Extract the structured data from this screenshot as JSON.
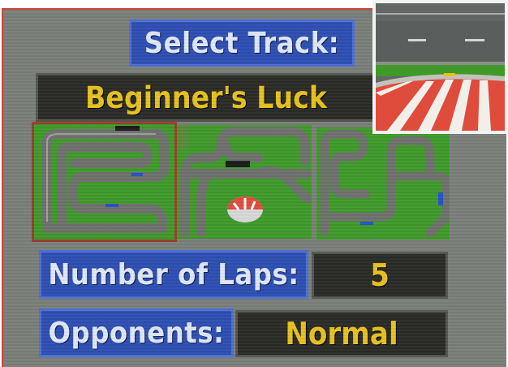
{
  "select_track": {
    "title": "Select Track:",
    "track_name": "Beginner's Luck"
  },
  "tracks": [
    {
      "id": "track-1",
      "selected": true
    },
    {
      "id": "track-2",
      "selected": false
    },
    {
      "id": "track-3",
      "selected": false
    }
  ],
  "laps": {
    "label": "Number of Laps:",
    "value": "5"
  },
  "opponents": {
    "label": "Opponents:",
    "value": "Normal"
  },
  "colors": {
    "label_bg": "#2e4fb3",
    "value_text": "#e6c21d",
    "selection_border": "#9a3f2a",
    "grass": "#3f9a2a",
    "road": "#6e716c"
  }
}
